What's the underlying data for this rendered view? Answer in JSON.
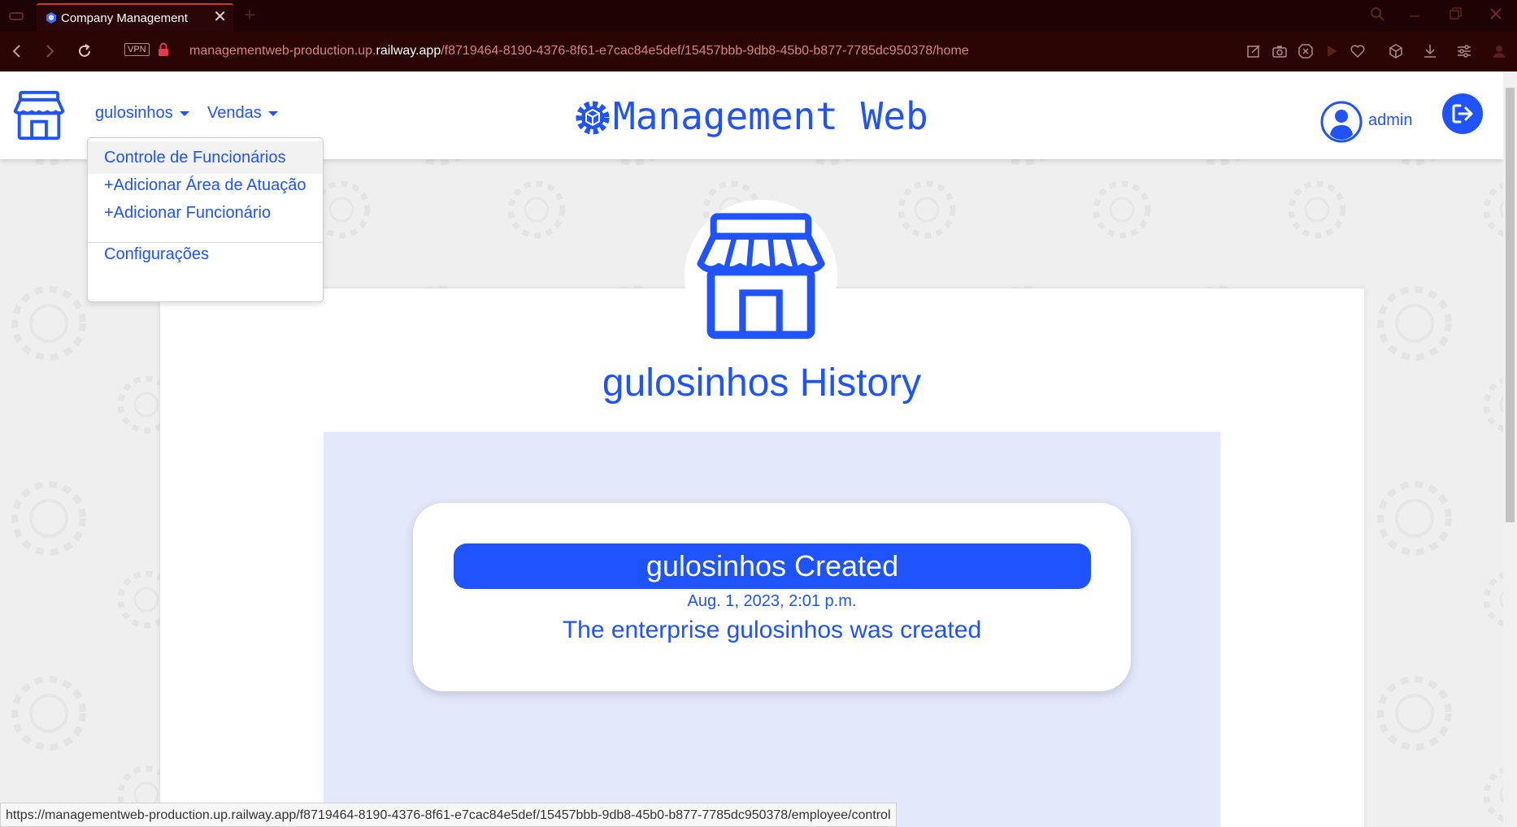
{
  "browser": {
    "tab_title": "Company Management",
    "vpn_label": "VPN",
    "url": {
      "prefix": "managementweb-production.up.",
      "domain": "railway.app",
      "path": "/f8719464-8190-4376-8f61-e7cac84e5def/15457bbb-9db8-45b0-b877-7785dc950378/home"
    },
    "status_url": "https://managementweb-production.up.railway.app/f8719464-8190-4376-8f61-e7cac84e5def/15457bbb-9db8-45b0-b877-7785dc950378/employee/control"
  },
  "navbar": {
    "menus": [
      "gulosinhos",
      "Vendas"
    ],
    "brand": "Management Web",
    "user": "admin"
  },
  "dropdown": {
    "items": [
      "Controle de Funcionários",
      "+Adicionar Área de Atuação",
      "+Adicionar Funcionário"
    ],
    "settings": "Configurações"
  },
  "main": {
    "title": "gulosinhos History",
    "events": [
      {
        "title": "gulosinhos Created",
        "date": "Aug. 1, 2023, 2:01 p.m.",
        "description": "The enterprise gulosinhos was created"
      }
    ]
  },
  "colors": {
    "primary": "#1f53ff",
    "chrome_dark": "#1d0303",
    "history_bg": "#e3e8fa"
  },
  "icons": [
    "shop-icon",
    "cube-gear-icon",
    "user-circle-icon",
    "logout-icon"
  ]
}
